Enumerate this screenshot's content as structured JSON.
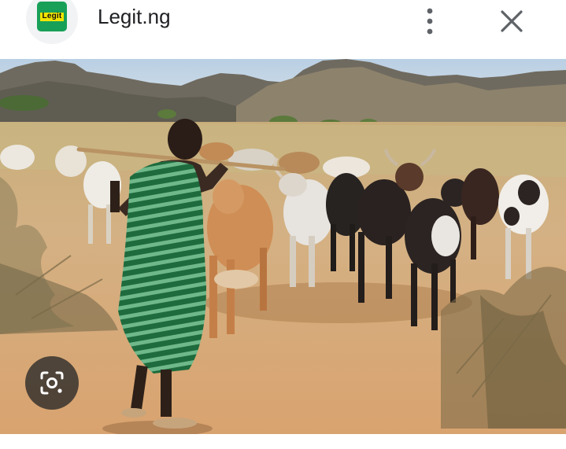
{
  "header": {
    "site_name": "Legit.ng",
    "favicon_text": "Legit",
    "favicon_icon": "legit-ng-logo",
    "more_icon": "more-vert-icon",
    "close_icon": "close-icon"
  },
  "image": {
    "alt": "",
    "lens_icon": "google-lens-icon"
  },
  "colors": {
    "favicon_green": "#18a058",
    "favicon_yellow": "#f2e400",
    "title_text": "#202124",
    "icon_gray": "#5f6368"
  }
}
